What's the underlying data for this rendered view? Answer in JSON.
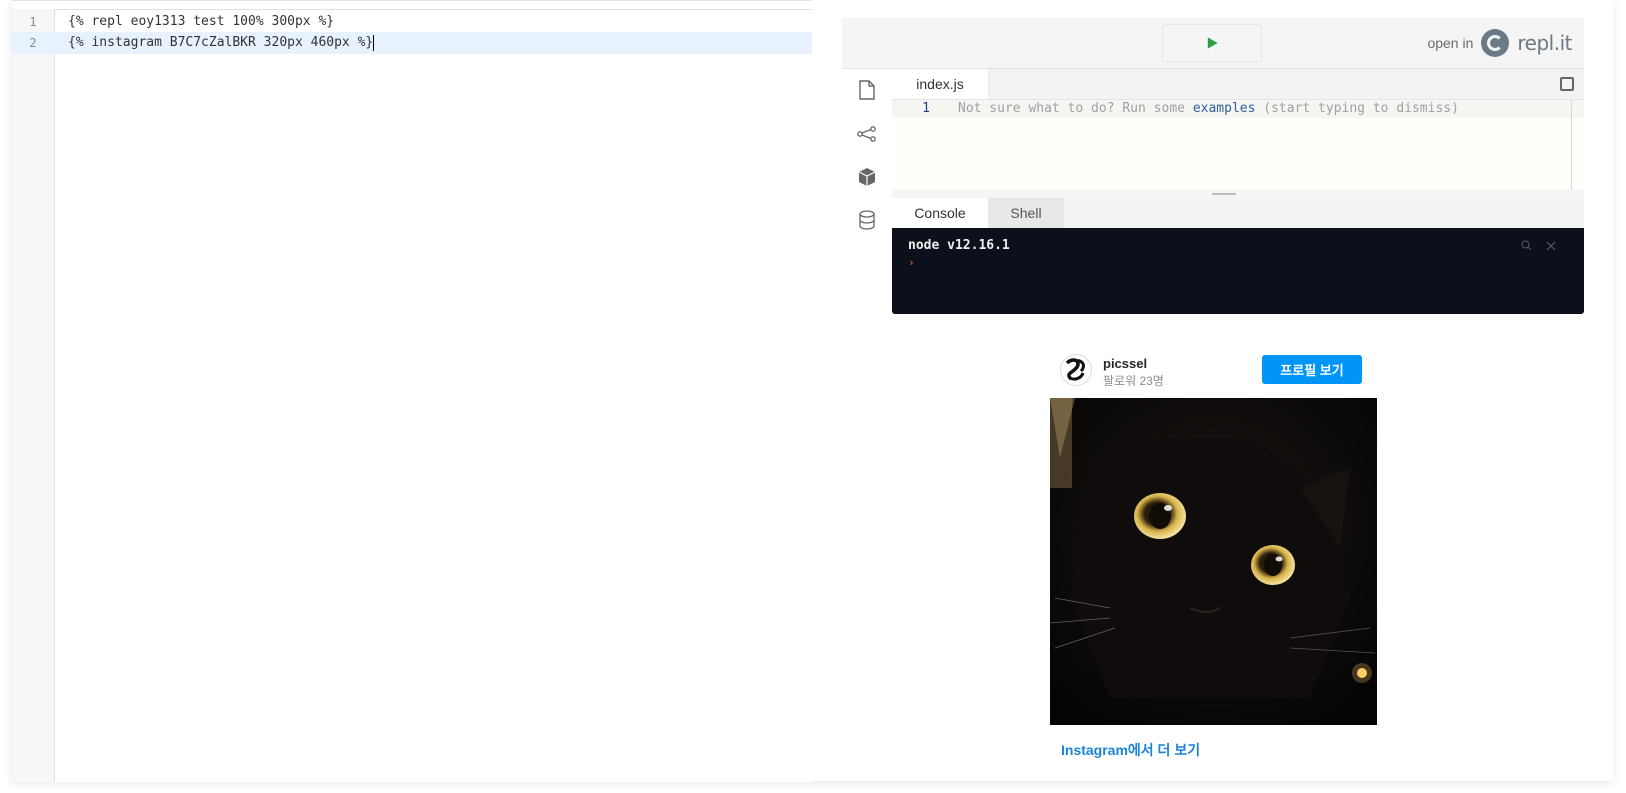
{
  "editor": {
    "lines": [
      {
        "number": "1",
        "text": "{% repl eoy1313 test 100% 300px %}"
      },
      {
        "number": "2",
        "text": "{% instagram B7C7cZalBKR 320px 460px %}"
      }
    ]
  },
  "repl": {
    "open_in_label": "open in",
    "logo_text": "repl.it",
    "run_icon": "play-icon",
    "file_tab": "index.js",
    "line_number": "1",
    "hint_prefix": "Not sure what to do? Run some ",
    "hint_link": "examples",
    "hint_suffix": " (start typing to dismiss)",
    "console_tabs": [
      "Console",
      "Shell"
    ],
    "terminal_output": "node v12.16.1",
    "prompt_glyph": "›",
    "sidebar_icons": [
      "file-icon",
      "share-icon",
      "package-icon",
      "database-icon"
    ],
    "accent_color": "#2e9e45"
  },
  "instagram": {
    "username": "picssel",
    "followers": "팔로워 23명",
    "profile_button": "프로필 보기",
    "more_link": "Instagram에서 더 보기",
    "button_color": "#0095f6"
  }
}
